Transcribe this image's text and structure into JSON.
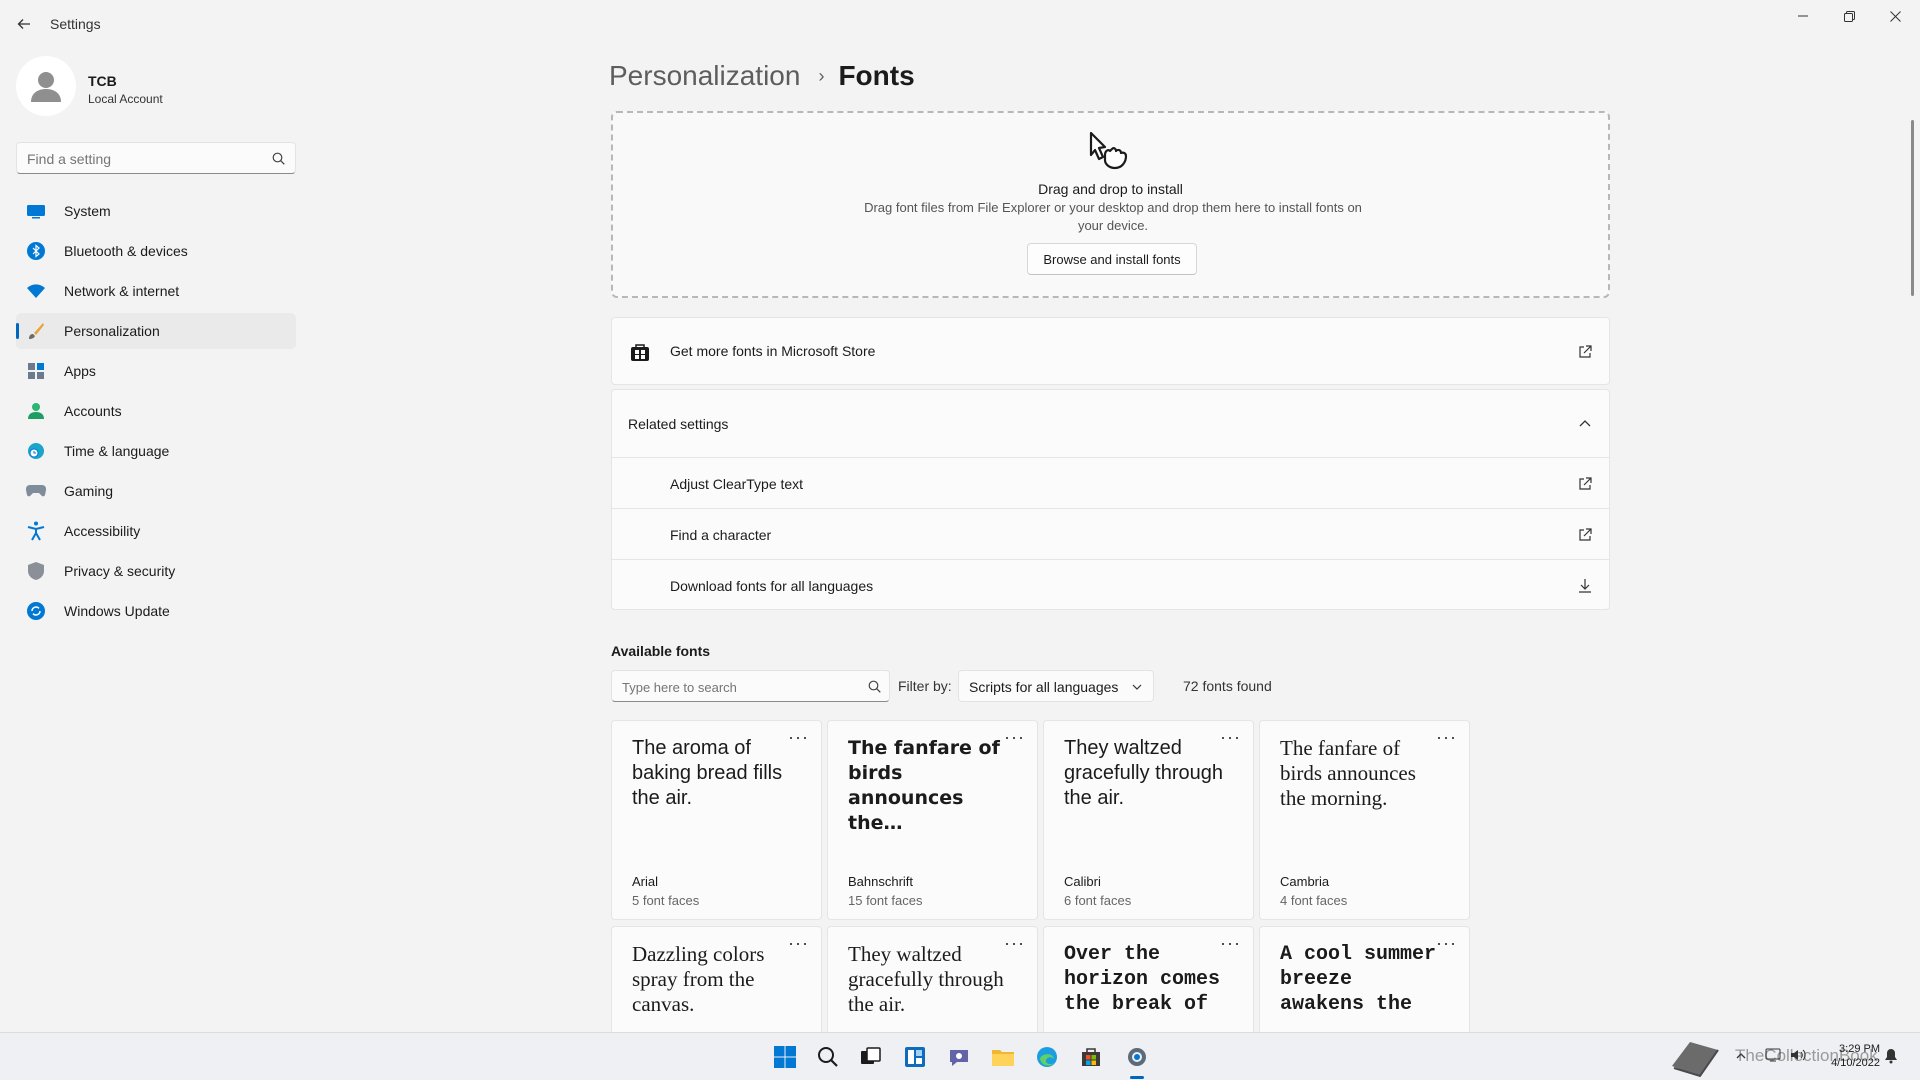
{
  "window": {
    "title": "Settings",
    "minimize_glyph": "─",
    "close_glyph": "✕"
  },
  "profile": {
    "name": "TCB",
    "account_type": "Local Account"
  },
  "search": {
    "placeholder": "Find a setting"
  },
  "nav": {
    "items": [
      {
        "label": "System",
        "icon": "system-icon",
        "active": false
      },
      {
        "label": "Bluetooth & devices",
        "icon": "bluetooth-icon",
        "active": false
      },
      {
        "label": "Network & internet",
        "icon": "wifi-icon",
        "active": false
      },
      {
        "label": "Personalization",
        "icon": "brush-icon",
        "active": true
      },
      {
        "label": "Apps",
        "icon": "apps-icon",
        "active": false
      },
      {
        "label": "Accounts",
        "icon": "person-icon",
        "active": false
      },
      {
        "label": "Time & language",
        "icon": "globe-clock-icon",
        "active": false
      },
      {
        "label": "Gaming",
        "icon": "gamepad-icon",
        "active": false
      },
      {
        "label": "Accessibility",
        "icon": "accessibility-icon",
        "active": false
      },
      {
        "label": "Privacy & security",
        "icon": "shield-icon",
        "active": false
      },
      {
        "label": "Windows Update",
        "icon": "update-icon",
        "active": false
      }
    ]
  },
  "breadcrumb": {
    "parent": "Personalization",
    "separator": "›",
    "current": "Fonts"
  },
  "dropzone": {
    "title": "Drag and drop to install",
    "description": "Drag font files from File Explorer or your desktop and drop them here to install fonts on your device.",
    "button_label": "Browse and install fonts"
  },
  "store_link": {
    "label": "Get more fonts in Microsoft Store"
  },
  "related_settings": {
    "header": "Related settings",
    "items": [
      {
        "label": "Adjust ClearType text",
        "action_icon": "external-link-icon"
      },
      {
        "label": "Find a character",
        "action_icon": "external-link-icon"
      },
      {
        "label": "Download fonts for all languages",
        "action_icon": "download-icon"
      }
    ]
  },
  "available_fonts": {
    "title": "Available fonts",
    "search_placeholder": "Type here to search",
    "filter_label": "Filter by:",
    "filter_value": "Scripts for all languages",
    "count_text": "72 fonts found",
    "more_glyph": "···",
    "fonts": [
      {
        "sample": "The aroma of baking bread fills the air.",
        "name": "Arial",
        "faces": "5 font faces",
        "style": "sans"
      },
      {
        "sample": "The fanfare of birds announces the…",
        "name": "Bahnschrift",
        "faces": "15 font faces",
        "style": "bold"
      },
      {
        "sample": "They waltzed gracefully through the air.",
        "name": "Calibri",
        "faces": "6 font faces",
        "style": "sans"
      },
      {
        "sample": "The fanfare of birds announces the morning.",
        "name": "Cambria",
        "faces": "4 font faces",
        "style": "serif"
      },
      {
        "sample": "Dazzling colors spray from the canvas.",
        "name": "",
        "faces": "",
        "style": "serif"
      },
      {
        "sample": "They waltzed gracefully through the air.",
        "name": "",
        "faces": "",
        "style": "serif"
      },
      {
        "sample": "Over the horizon comes the break of",
        "name": "",
        "faces": "",
        "style": "mono"
      },
      {
        "sample": "A cool summer breeze awakens the",
        "name": "",
        "faces": "",
        "style": "mono"
      }
    ]
  },
  "taskbar": {
    "icons": [
      "windows-start-icon",
      "search-icon",
      "task-view-icon",
      "widgets-icon",
      "chat-icon",
      "file-explorer-icon",
      "edge-icon",
      "store-icon",
      "settings-icon"
    ],
    "clock_time": "3:29 PM",
    "clock_date": "4/10/2022",
    "watermark": "TheCollectionBook"
  },
  "colors": {
    "accent": "#0067c0",
    "background": "#f3f3f3"
  }
}
